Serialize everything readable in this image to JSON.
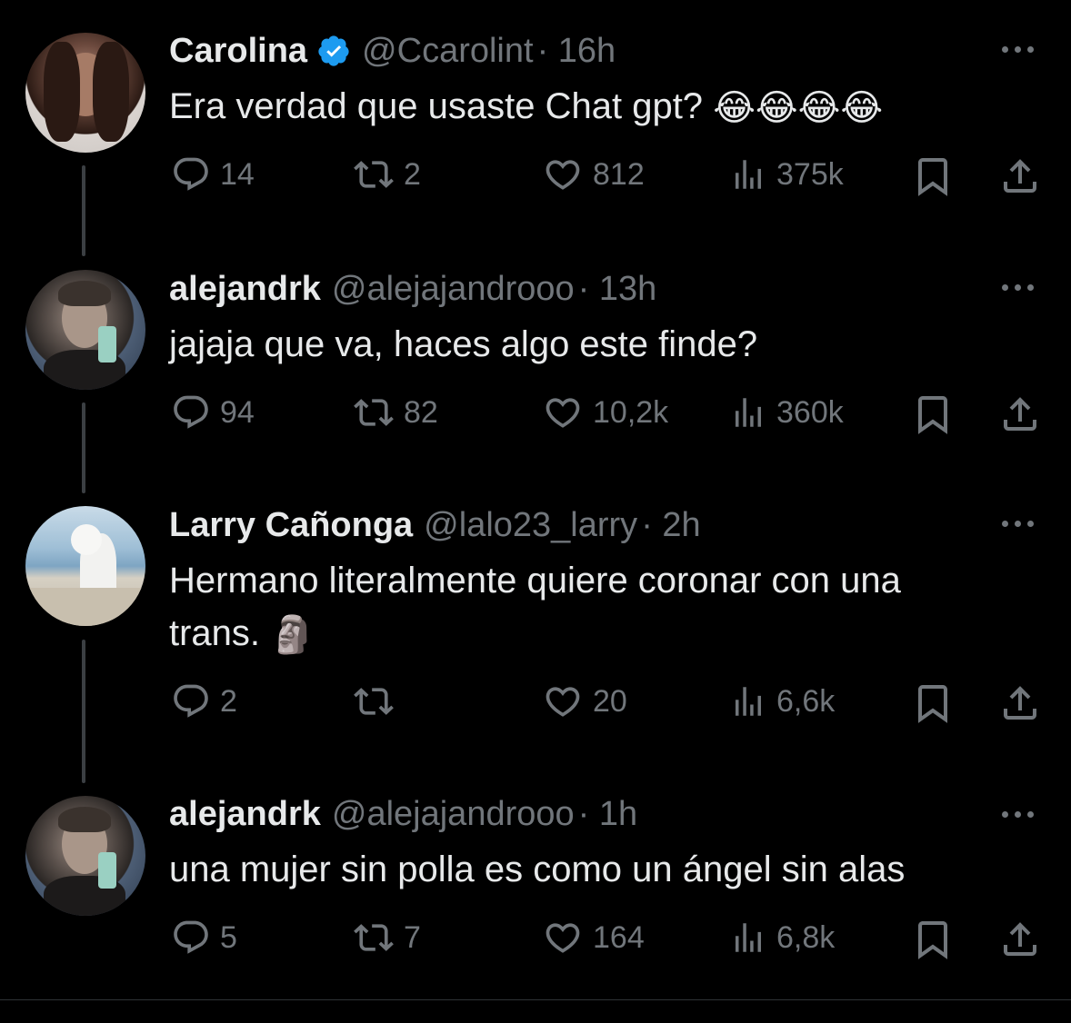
{
  "tweets": [
    {
      "name": "Carolina",
      "verified": true,
      "handle": "@Ccarolint",
      "time": "· 16h",
      "text": "Era verdad que usaste Chat gpt?",
      "emoji": "😂😂😂😂",
      "replies": "14",
      "retweets": "2",
      "likes": "812",
      "views": "375k"
    },
    {
      "name": "alejandrk",
      "verified": false,
      "handle": "@alejajandrooo",
      "time": "· 13h",
      "text": "jajaja que va, haces algo este finde?",
      "emoji": "",
      "replies": "94",
      "retweets": "82",
      "likes": "10,2k",
      "views": "360k"
    },
    {
      "name": "Larry Cañonga",
      "verified": false,
      "handle": "@lalo23_larry",
      "time": "· 2h",
      "text_line1": "Hermano literalmente quiere coronar con una",
      "text_line2": "trans.",
      "emoji": "🗿",
      "replies": "2",
      "retweets": "",
      "likes": "20",
      "views": "6,6k"
    },
    {
      "name": "alejandrk",
      "verified": false,
      "handle": "@alejajandrooo",
      "time": "· 1h",
      "text": "una mujer sin polla es como un ángel sin alas",
      "emoji": "",
      "replies": "5",
      "retweets": "7",
      "likes": "164",
      "views": "6,8k"
    }
  ],
  "icons": {
    "reply": "reply-icon",
    "retweet": "retweet-icon",
    "like": "heart-icon",
    "views": "views-icon",
    "bookmark": "bookmark-icon",
    "share": "share-icon",
    "more": "more-icon",
    "verified": "verified-badge-icon"
  },
  "colors": {
    "background": "#000000",
    "text": "#e7e9ea",
    "secondary": "#71767b",
    "verified": "#1d9bf0",
    "thread_line": "#3b3f43"
  }
}
